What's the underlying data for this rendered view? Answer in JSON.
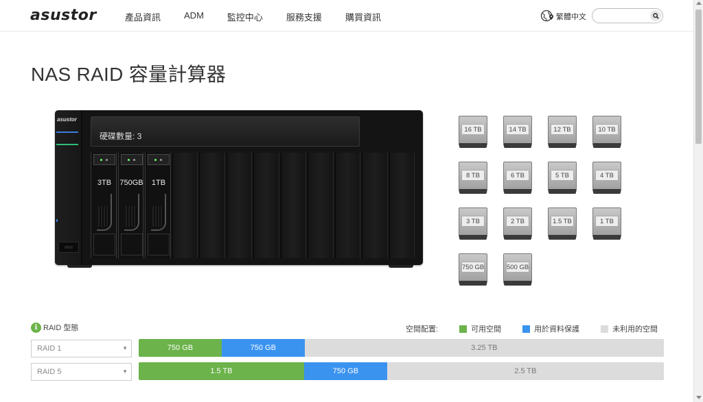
{
  "header": {
    "logo": "asustor",
    "nav": [
      "產品資訊",
      "ADM",
      "監控中心",
      "服務支援",
      "購買資訊"
    ],
    "language": "繁體中文",
    "search_placeholder": ""
  },
  "page_title": "NAS RAID 容量計算器",
  "nas": {
    "brand": "asustor",
    "screen_text": "硬碟數量: 3",
    "bays": [
      "3TB",
      "750GB",
      "1TB",
      "",
      "",
      "",
      "",
      "",
      "",
      "",
      "",
      ""
    ]
  },
  "disks": [
    "16 TB",
    "14 TB",
    "12 TB",
    "10 TB",
    "8 TB",
    "6 TB",
    "5 TB",
    "4 TB",
    "3 TB",
    "2 TB",
    "1.5 TB",
    "1 TB",
    "750 GB",
    "500 GB"
  ],
  "raid": {
    "heading": "RAID 型態",
    "legend_title": "空間配置:",
    "legend": [
      {
        "label": "可用空間",
        "color": "#6bb34a"
      },
      {
        "label": "用於資料保護",
        "color": "#3b93f0"
      },
      {
        "label": "未利用的空間",
        "color": "#dcdcdc"
      }
    ],
    "rows": [
      {
        "select": "RAID 1",
        "segments": [
          {
            "label": "750 GB",
            "kind": "usable",
            "share": 0.158
          },
          {
            "label": "750 GB",
            "kind": "protection",
            "share": 0.158
          },
          {
            "label": "3.25 TB",
            "kind": "unused",
            "share": 0.684
          }
        ]
      },
      {
        "select": "RAID 5",
        "segments": [
          {
            "label": "1.5 TB",
            "kind": "usable",
            "share": 0.315
          },
          {
            "label": "750 GB",
            "kind": "protection",
            "share": 0.158
          },
          {
            "label": "2.5 TB",
            "kind": "unused",
            "share": 0.527
          }
        ]
      }
    ]
  }
}
